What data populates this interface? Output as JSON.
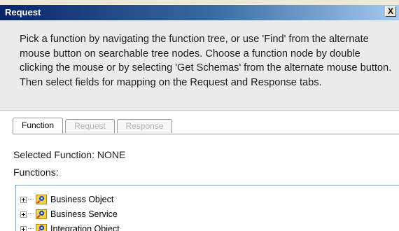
{
  "dialog": {
    "title": "Request",
    "close_label": "X"
  },
  "instructions": {
    "text": "Pick a function by navigating the function tree, or use 'Find' from the alternate mouse button on searchable tree nodes. Choose a function node by double clicking the mouse or by selecting 'Get Schemas' from the alternate mouse button. Then select fields for mapping on the Request and Response tabs."
  },
  "tabs": [
    {
      "label": "Function",
      "state": "active"
    },
    {
      "label": "Request",
      "state": "disabled"
    },
    {
      "label": "Response",
      "state": "disabled"
    }
  ],
  "main": {
    "selected_function": "Selected Function: NONE",
    "functions_label": "Functions:"
  },
  "tree": {
    "nodes": [
      {
        "label": "Business Object",
        "icon": "search-folder-icon",
        "expanded": false
      },
      {
        "label": "Business Service",
        "icon": "search-folder-icon",
        "expanded": false
      },
      {
        "label": "Integration Object",
        "icon": "search-folder-icon",
        "expanded": false
      }
    ]
  }
}
